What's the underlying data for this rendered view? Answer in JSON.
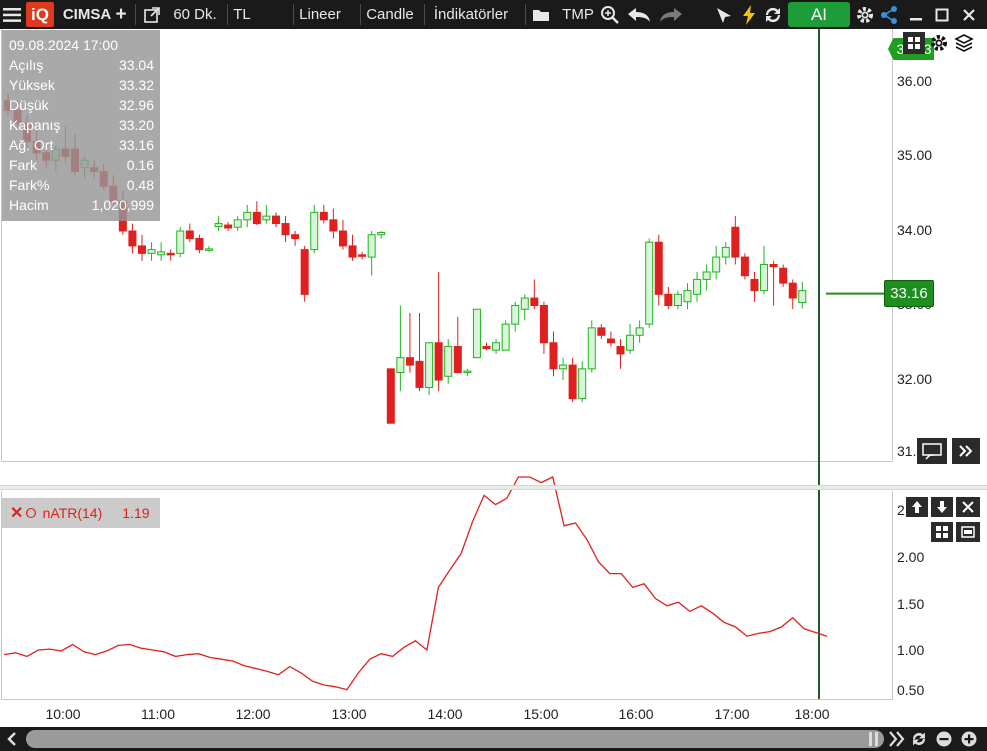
{
  "toolbar": {
    "logo": "iQ",
    "symbol": "CIMSA",
    "period": "60 Dk.",
    "currency": "TL",
    "scale": "Lineer",
    "chart_type": "Candle",
    "indicators": "İndikatörler",
    "template": "TMP",
    "ai_label": "AI"
  },
  "info": {
    "datetime": "09.08.2024 17:00",
    "rows": [
      {
        "label": "Açılış",
        "value": "33.04"
      },
      {
        "label": "Yüksek",
        "value": "33.32"
      },
      {
        "label": "Düşük",
        "value": "32.96"
      },
      {
        "label": "Kapanış",
        "value": "33.20"
      },
      {
        "label": "Ağ. Ort",
        "value": "33.16"
      },
      {
        "label": "Fark",
        "value": "0.16"
      },
      {
        "label": "Fark%",
        "value": "0.48"
      },
      {
        "label": "Hacim",
        "value": "1,020,999"
      }
    ]
  },
  "price_axis": [
    "36.00",
    "35.00",
    "34.00",
    "33.00",
    "32.00",
    "31."
  ],
  "last_price": "33.16",
  "top_badge": "36.43",
  "indicator": {
    "name": "nATR(14)",
    "value": "1.19",
    "axis": [
      "2",
      "2.00",
      "1.50",
      "1.00",
      "0.50"
    ],
    "color": "#e0201e"
  },
  "time_axis": [
    "10:00",
    "11:00",
    "12:00",
    "13:00",
    "14:00",
    "15:00",
    "16:00",
    "17:00",
    "18:00"
  ],
  "colors": {
    "up": "#1fb51f",
    "down": "#e0201e",
    "accent": "#1f9c3a"
  },
  "chart_data": {
    "type": "candlestick",
    "ylim": [
      31.0,
      36.5
    ],
    "candles": [
      {
        "o": 35.75,
        "h": 35.85,
        "l": 35.55,
        "c": 35.62
      },
      {
        "o": 35.62,
        "h": 35.75,
        "l": 35.4,
        "c": 35.45
      },
      {
        "o": 35.45,
        "h": 35.55,
        "l": 35.1,
        "c": 35.2
      },
      {
        "o": 35.2,
        "h": 35.35,
        "l": 34.95,
        "c": 35.05
      },
      {
        "o": 35.05,
        "h": 35.2,
        "l": 34.85,
        "c": 34.95
      },
      {
        "o": 34.95,
        "h": 35.15,
        "l": 34.8,
        "c": 35.1
      },
      {
        "o": 35.1,
        "h": 35.4,
        "l": 34.9,
        "c": 35.0
      },
      {
        "o": 35.1,
        "h": 35.3,
        "l": 34.75,
        "c": 34.8
      },
      {
        "o": 34.85,
        "h": 35.0,
        "l": 34.7,
        "c": 34.95
      },
      {
        "o": 34.85,
        "h": 34.95,
        "l": 34.7,
        "c": 34.8
      },
      {
        "o": 34.8,
        "h": 34.9,
        "l": 34.55,
        "c": 34.6
      },
      {
        "o": 34.6,
        "h": 34.75,
        "l": 34.35,
        "c": 34.4
      },
      {
        "o": 34.4,
        "h": 34.55,
        "l": 33.95,
        "c": 34.0
      },
      {
        "o": 34.0,
        "h": 34.1,
        "l": 33.7,
        "c": 33.8
      },
      {
        "o": 33.8,
        "h": 33.95,
        "l": 33.6,
        "c": 33.7
      },
      {
        "o": 33.7,
        "h": 33.85,
        "l": 33.6,
        "c": 33.75
      },
      {
        "o": 33.68,
        "h": 33.85,
        "l": 33.6,
        "c": 33.72
      },
      {
        "o": 33.7,
        "h": 33.75,
        "l": 33.6,
        "c": 33.68
      },
      {
        "o": 33.7,
        "h": 34.05,
        "l": 33.65,
        "c": 34.0
      },
      {
        "o": 34.0,
        "h": 34.1,
        "l": 33.85,
        "c": 33.9
      },
      {
        "o": 33.9,
        "h": 33.95,
        "l": 33.7,
        "c": 33.75
      },
      {
        "o": 33.75,
        "h": 33.8,
        "l": 33.72,
        "c": 33.76
      },
      {
        "o": 34.06,
        "h": 34.2,
        "l": 34.0,
        "c": 34.1
      },
      {
        "o": 34.08,
        "h": 34.12,
        "l": 34.0,
        "c": 34.04
      },
      {
        "o": 34.05,
        "h": 34.2,
        "l": 34.0,
        "c": 34.15
      },
      {
        "o": 34.15,
        "h": 34.35,
        "l": 34.05,
        "c": 34.25
      },
      {
        "o": 34.25,
        "h": 34.4,
        "l": 34.08,
        "c": 34.1
      },
      {
        "o": 34.15,
        "h": 34.35,
        "l": 34.1,
        "c": 34.2
      },
      {
        "o": 34.2,
        "h": 34.25,
        "l": 34.05,
        "c": 34.1
      },
      {
        "o": 34.1,
        "h": 34.2,
        "l": 33.85,
        "c": 33.95
      },
      {
        "o": 33.95,
        "h": 34.0,
        "l": 33.8,
        "c": 33.9
      },
      {
        "o": 33.75,
        "h": 33.8,
        "l": 33.05,
        "c": 33.15
      },
      {
        "o": 33.75,
        "h": 34.35,
        "l": 33.7,
        "c": 34.25
      },
      {
        "o": 34.25,
        "h": 34.35,
        "l": 34.1,
        "c": 34.15
      },
      {
        "o": 34.15,
        "h": 34.3,
        "l": 33.9,
        "c": 34.0
      },
      {
        "o": 34.0,
        "h": 34.15,
        "l": 33.75,
        "c": 33.8
      },
      {
        "o": 33.8,
        "h": 33.95,
        "l": 33.6,
        "c": 33.65
      },
      {
        "o": 33.68,
        "h": 33.72,
        "l": 33.62,
        "c": 33.66
      },
      {
        "o": 33.65,
        "h": 34.0,
        "l": 33.4,
        "c": 33.95
      },
      {
        "o": 33.95,
        "h": 34.0,
        "l": 33.9,
        "c": 33.98
      },
      {
        "o": 32.15,
        "h": 32.15,
        "l": 31.45,
        "c": 31.42
      },
      {
        "o": 32.1,
        "h": 33.0,
        "l": 31.85,
        "c": 32.3
      },
      {
        "o": 32.3,
        "h": 32.9,
        "l": 32.1,
        "c": 32.2
      },
      {
        "o": 32.25,
        "h": 32.9,
        "l": 31.85,
        "c": 31.9
      },
      {
        "o": 31.9,
        "h": 32.3,
        "l": 31.8,
        "c": 32.5
      },
      {
        "o": 32.5,
        "h": 33.45,
        "l": 31.85,
        "c": 32.0
      },
      {
        "o": 32.05,
        "h": 32.55,
        "l": 31.95,
        "c": 32.45
      },
      {
        "o": 32.45,
        "h": 32.85,
        "l": 32.1,
        "c": 32.1
      },
      {
        "o": 32.1,
        "h": 32.15,
        "l": 32.05,
        "c": 32.12
      },
      {
        "o": 32.3,
        "h": 32.95,
        "l": 32.3,
        "c": 32.95
      },
      {
        "o": 32.45,
        "h": 32.5,
        "l": 32.4,
        "c": 32.42
      },
      {
        "o": 32.4,
        "h": 32.55,
        "l": 32.35,
        "c": 32.5
      },
      {
        "o": 32.4,
        "h": 32.8,
        "l": 32.4,
        "c": 32.75
      },
      {
        "o": 32.75,
        "h": 33.05,
        "l": 32.65,
        "c": 33.0
      },
      {
        "o": 32.95,
        "h": 33.15,
        "l": 32.8,
        "c": 33.1
      },
      {
        "o": 33.1,
        "h": 33.35,
        "l": 32.95,
        "c": 33.0
      },
      {
        "o": 33.0,
        "h": 33.05,
        "l": 32.35,
        "c": 32.5
      },
      {
        "o": 32.5,
        "h": 32.65,
        "l": 32.05,
        "c": 32.15
      },
      {
        "o": 32.15,
        "h": 32.3,
        "l": 32.0,
        "c": 32.2
      },
      {
        "o": 32.2,
        "h": 32.3,
        "l": 31.7,
        "c": 31.75
      },
      {
        "o": 31.75,
        "h": 32.25,
        "l": 31.7,
        "c": 32.15
      },
      {
        "o": 32.15,
        "h": 32.8,
        "l": 32.1,
        "c": 32.7
      },
      {
        "o": 32.7,
        "h": 32.75,
        "l": 32.55,
        "c": 32.6
      },
      {
        "o": 32.55,
        "h": 32.65,
        "l": 32.45,
        "c": 32.5
      },
      {
        "o": 32.45,
        "h": 32.55,
        "l": 32.15,
        "c": 32.35
      },
      {
        "o": 32.4,
        "h": 32.75,
        "l": 32.35,
        "c": 32.6
      },
      {
        "o": 32.6,
        "h": 32.8,
        "l": 32.5,
        "c": 32.7
      },
      {
        "o": 32.75,
        "h": 33.9,
        "l": 32.7,
        "c": 33.85
      },
      {
        "o": 33.85,
        "h": 33.95,
        "l": 33.0,
        "c": 33.15
      },
      {
        "o": 33.15,
        "h": 33.25,
        "l": 32.95,
        "c": 33.0
      },
      {
        "o": 33.0,
        "h": 33.2,
        "l": 32.95,
        "c": 33.15
      },
      {
        "o": 33.05,
        "h": 33.3,
        "l": 32.95,
        "c": 33.2
      },
      {
        "o": 33.15,
        "h": 33.45,
        "l": 33.05,
        "c": 33.35
      },
      {
        "o": 33.35,
        "h": 33.55,
        "l": 33.2,
        "c": 33.45
      },
      {
        "o": 33.45,
        "h": 33.8,
        "l": 33.35,
        "c": 33.65
      },
      {
        "o": 33.65,
        "h": 33.85,
        "l": 33.55,
        "c": 33.78
      },
      {
        "o": 34.05,
        "h": 34.2,
        "l": 33.55,
        "c": 33.65
      },
      {
        "o": 33.65,
        "h": 33.7,
        "l": 33.35,
        "c": 33.4
      },
      {
        "o": 33.35,
        "h": 33.45,
        "l": 33.05,
        "c": 33.2
      },
      {
        "o": 33.2,
        "h": 33.8,
        "l": 33.15,
        "c": 33.55
      },
      {
        "o": 33.55,
        "h": 33.6,
        "l": 33.0,
        "c": 33.52
      },
      {
        "o": 33.5,
        "h": 33.55,
        "l": 33.25,
        "c": 33.3
      },
      {
        "o": 33.3,
        "h": 33.35,
        "l": 32.95,
        "c": 33.1
      },
      {
        "o": 33.04,
        "h": 33.32,
        "l": 32.96,
        "c": 33.2
      }
    ],
    "natr": [
      0.95,
      0.97,
      0.93,
      1.0,
      1.01,
      0.99,
      1.06,
      0.98,
      0.95,
      0.99,
      1.05,
      1.06,
      1.02,
      1.0,
      0.98,
      0.93,
      0.95,
      0.96,
      0.92,
      0.9,
      0.88,
      0.83,
      0.8,
      0.77,
      0.73,
      0.82,
      0.75,
      0.66,
      0.62,
      0.6,
      0.57,
      0.75,
      0.9,
      0.96,
      0.93,
      1.03,
      1.1,
      1.0,
      1.68,
      1.87,
      2.05,
      2.4,
      2.68,
      2.58,
      2.65,
      2.88,
      2.88,
      2.82,
      2.88,
      2.35,
      2.38,
      2.2,
      1.96,
      1.83,
      1.83,
      1.68,
      1.72,
      1.56,
      1.48,
      1.52,
      1.42,
      1.48,
      1.4,
      1.3,
      1.25,
      1.15,
      1.18,
      1.2,
      1.25,
      1.35,
      1.23,
      1.19,
      1.15
    ]
  }
}
